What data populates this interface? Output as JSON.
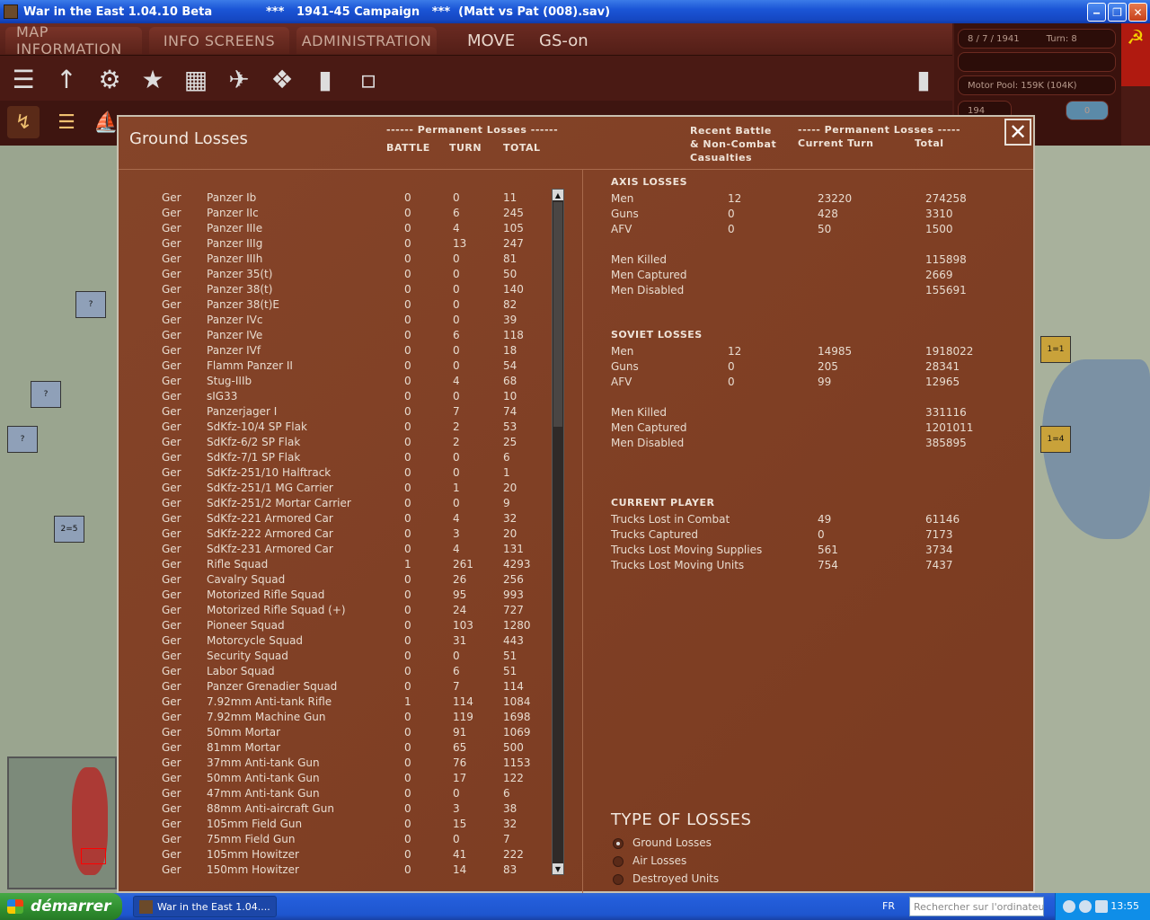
{
  "window": {
    "title_app": "War in the East 1.04.10 Beta",
    "title_file": "***   1941-45 Campaign   ***  (Matt vs Pat (008).sav)",
    "min": "‒",
    "max": "❐",
    "close": "✕"
  },
  "menu": {
    "tabs": [
      "MAP INFORMATION",
      "INFO SCREENS",
      "ADMINISTRATION"
    ],
    "mode": "MOVE",
    "gs": "GS-on"
  },
  "info_panel": {
    "date": "8 / 7 / 1941",
    "turn": "Turn: 8",
    "motor_pool": "Motor Pool:  159K (104K)",
    "num": "194",
    "zero": "0"
  },
  "dialog": {
    "title": "Ground Losses",
    "close": "✕",
    "left_header_group": "------ Permanent Losses ------",
    "col_battle": "BATTLE",
    "col_turn": "TURN",
    "col_total": "TOTAL",
    "right_header_recent": "Recent Battle\n& Non-Combat\nCasualties",
    "right_header_group": "----- Permanent Losses -----",
    "right_col_current": "Current Turn",
    "right_col_total": "Total"
  },
  "ground_losses": [
    [
      "Ger",
      "Panzer Ib",
      "0",
      "0",
      "11"
    ],
    [
      "Ger",
      "Panzer IIc",
      "0",
      "6",
      "245"
    ],
    [
      "Ger",
      "Panzer IIIe",
      "0",
      "4",
      "105"
    ],
    [
      "Ger",
      "Panzer IIIg",
      "0",
      "13",
      "247"
    ],
    [
      "Ger",
      "Panzer IIIh",
      "0",
      "0",
      "81"
    ],
    [
      "Ger",
      "Panzer 35(t)",
      "0",
      "0",
      "50"
    ],
    [
      "Ger",
      "Panzer 38(t)",
      "0",
      "0",
      "140"
    ],
    [
      "Ger",
      "Panzer 38(t)E",
      "0",
      "0",
      "82"
    ],
    [
      "Ger",
      "Panzer IVc",
      "0",
      "0",
      "39"
    ],
    [
      "Ger",
      "Panzer IVe",
      "0",
      "6",
      "118"
    ],
    [
      "Ger",
      "Panzer IVf",
      "0",
      "0",
      "18"
    ],
    [
      "Ger",
      "Flamm Panzer II",
      "0",
      "0",
      "54"
    ],
    [
      "Ger",
      "Stug-IIIb",
      "0",
      "4",
      "68"
    ],
    [
      "Ger",
      "sIG33",
      "0",
      "0",
      "10"
    ],
    [
      "Ger",
      "Panzerjager I",
      "0",
      "7",
      "74"
    ],
    [
      "Ger",
      "SdKfz-10/4 SP Flak",
      "0",
      "2",
      "53"
    ],
    [
      "Ger",
      "SdKfz-6/2 SP Flak",
      "0",
      "2",
      "25"
    ],
    [
      "Ger",
      "SdKfz-7/1 SP Flak",
      "0",
      "0",
      "6"
    ],
    [
      "Ger",
      "SdKfz-251/10 Halftrack",
      "0",
      "0",
      "1"
    ],
    [
      "Ger",
      "SdKfz-251/1 MG Carrier",
      "0",
      "1",
      "20"
    ],
    [
      "Ger",
      "SdKfz-251/2 Mortar Carrier",
      "0",
      "0",
      "9"
    ],
    [
      "Ger",
      "SdKfz-221 Armored Car",
      "0",
      "4",
      "32"
    ],
    [
      "Ger",
      "SdKfz-222 Armored Car",
      "0",
      "3",
      "20"
    ],
    [
      "Ger",
      "SdKfz-231 Armored Car",
      "0",
      "4",
      "131"
    ],
    [
      "Ger",
      "Rifle Squad",
      "1",
      "261",
      "4293"
    ],
    [
      "Ger",
      "Cavalry Squad",
      "0",
      "26",
      "256"
    ],
    [
      "Ger",
      "Motorized Rifle Squad",
      "0",
      "95",
      "993"
    ],
    [
      "Ger",
      "Motorized Rifle Squad (+)",
      "0",
      "24",
      "727"
    ],
    [
      "Ger",
      "Pioneer Squad",
      "0",
      "103",
      "1280"
    ],
    [
      "Ger",
      "Motorcycle Squad",
      "0",
      "31",
      "443"
    ],
    [
      "Ger",
      "Security Squad",
      "0",
      "0",
      "51"
    ],
    [
      "Ger",
      "Labor Squad",
      "0",
      "6",
      "51"
    ],
    [
      "Ger",
      "Panzer Grenadier Squad",
      "0",
      "7",
      "114"
    ],
    [
      "Ger",
      "7.92mm Anti-tank Rifle",
      "1",
      "114",
      "1084"
    ],
    [
      "Ger",
      "7.92mm Machine Gun",
      "0",
      "119",
      "1698"
    ],
    [
      "Ger",
      "50mm Mortar",
      "0",
      "91",
      "1069"
    ],
    [
      "Ger",
      "81mm Mortar",
      "0",
      "65",
      "500"
    ],
    [
      "Ger",
      "37mm Anti-tank Gun",
      "0",
      "76",
      "1153"
    ],
    [
      "Ger",
      "50mm Anti-tank Gun",
      "0",
      "17",
      "122"
    ],
    [
      "Ger",
      "47mm Anti-tank Gun",
      "0",
      "0",
      "6"
    ],
    [
      "Ger",
      "88mm Anti-aircraft Gun",
      "0",
      "3",
      "38"
    ],
    [
      "Ger",
      "105mm Field Gun",
      "0",
      "15",
      "32"
    ],
    [
      "Ger",
      "75mm Field Gun",
      "0",
      "0",
      "7"
    ],
    [
      "Ger",
      "105mm Howitzer",
      "0",
      "41",
      "222"
    ],
    [
      "Ger",
      "150mm Howitzer",
      "0",
      "14",
      "83"
    ]
  ],
  "summary": {
    "axis_title": "AXIS LOSSES",
    "axis": [
      [
        "Men",
        "12",
        "23220",
        "274258"
      ],
      [
        "Guns",
        "0",
        "428",
        "3310"
      ],
      [
        "AFV",
        "0",
        "50",
        "1500"
      ]
    ],
    "axis_detail": [
      [
        "Men Killed",
        "115898"
      ],
      [
        "Men Captured",
        "2669"
      ],
      [
        "Men Disabled",
        "155691"
      ]
    ],
    "soviet_title": "SOVIET LOSSES",
    "soviet": [
      [
        "Men",
        "12",
        "14985",
        "1918022"
      ],
      [
        "Guns",
        "0",
        "205",
        "28341"
      ],
      [
        "AFV",
        "0",
        "99",
        "12965"
      ]
    ],
    "soviet_detail": [
      [
        "Men Killed",
        "331116"
      ],
      [
        "Men Captured",
        "1201011"
      ],
      [
        "Men Disabled",
        "385895"
      ]
    ],
    "player_title": "CURRENT PLAYER",
    "player": [
      [
        "Trucks Lost in Combat",
        "49",
        "61146"
      ],
      [
        "Trucks Captured",
        "0",
        "7173"
      ],
      [
        "Trucks Lost Moving Supplies",
        "561",
        "3734"
      ],
      [
        "Trucks Lost Moving Units",
        "754",
        "7437"
      ]
    ]
  },
  "type_of_losses": {
    "title": "TYPE OF LOSSES",
    "options": [
      "Ground Losses",
      "Air Losses",
      "Destroyed Units"
    ],
    "selected": 0
  },
  "map_units": [
    {
      "label": "?"
    },
    {
      "label": "?"
    },
    {
      "label": "?"
    },
    {
      "label": "2=5"
    },
    {
      "label": "1=1"
    },
    {
      "label": "1=4"
    }
  ],
  "taskbar": {
    "start": "démarrer",
    "task": "War in the East 1.04....",
    "lang": "FR",
    "search_placeholder": "Rechercher sur l'ordinateur",
    "clock": "13:55"
  }
}
